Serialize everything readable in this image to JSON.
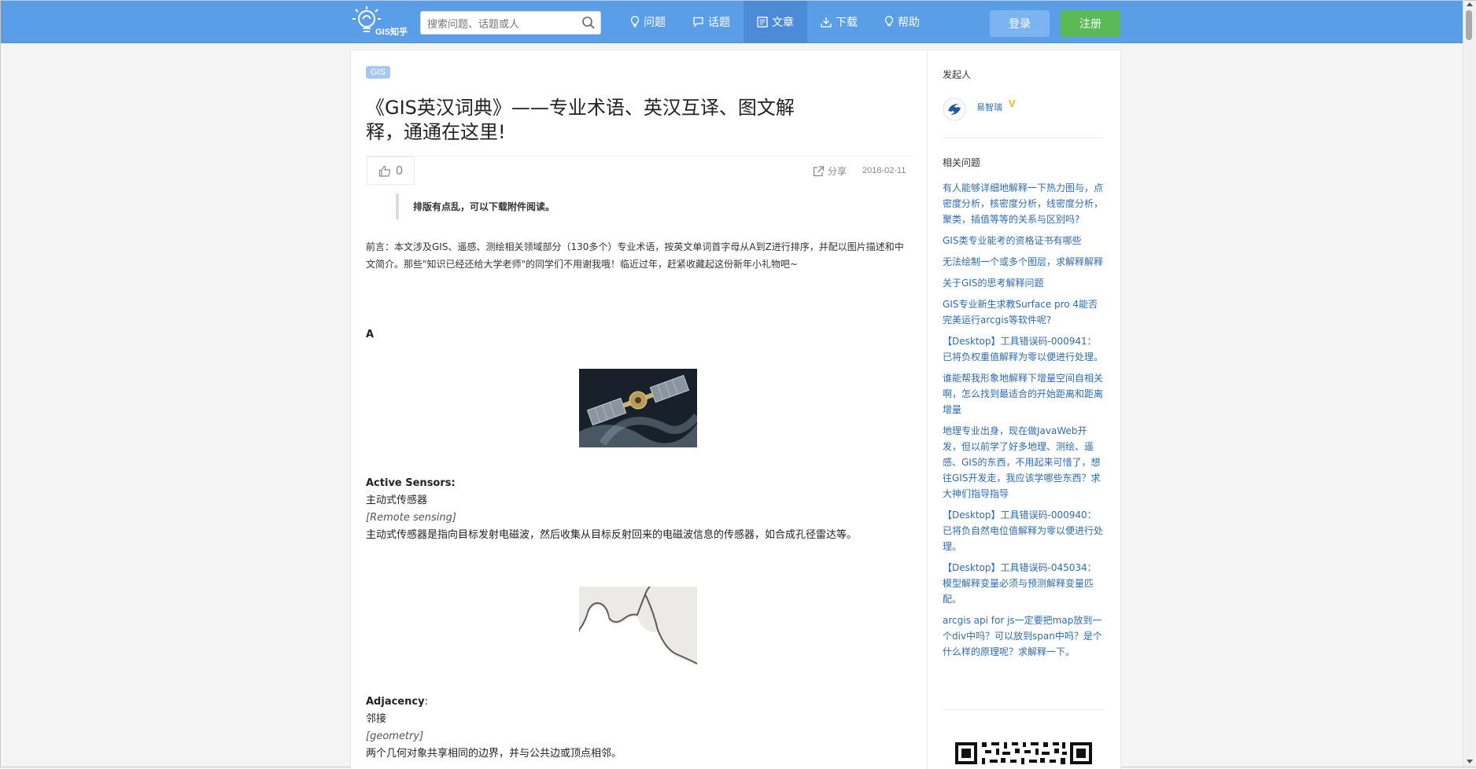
{
  "header": {
    "logo_text": "GIS知乎",
    "search_placeholder": "搜索问题、话题或人",
    "nav": [
      {
        "label": "问题",
        "icon": "bulb-icon"
      },
      {
        "label": "话题",
        "icon": "chat-icon"
      },
      {
        "label": "文章",
        "icon": "article-icon"
      },
      {
        "label": "下载",
        "icon": "download-icon"
      },
      {
        "label": "帮助",
        "icon": "help-bulb-icon"
      }
    ],
    "login": "登录",
    "register": "注册"
  },
  "article": {
    "tag": "GIS",
    "title_line1": "《GIS英汉词典》——专业术语、英汉互译、图文解",
    "title_line2": "释，通通在这里!",
    "likes": "0",
    "share": "分享",
    "date": "2018-02-11",
    "quote": "排版有点乱，可以下载附件阅读。",
    "intro": "前言：本文涉及GIS、遥感、测绘相关领域部分（130多个）专业术语，按英文单词首字母从A到Z进行排序，并配以图片描述和中文简介。那些\"知识已经还给大学老师\"的同学们不用谢我哦！临近过年，赶紧收藏起这份新年小礼物吧~",
    "section_letter": "A",
    "terms": [
      {
        "en": "Active Sensors:",
        "zh": "主动式传感器",
        "category": "[Remote sensing]",
        "desc": "主动式传感器是指向目标发射电磁波，然后收集从目标反射回来的电磁波信息的传感器，如合成孔径雷达等。"
      },
      {
        "en": "Adjacency",
        "en_suffix": ":",
        "zh": "邻接",
        "category": "[geometry]",
        "desc": "两个几何对象共享相同的边界，并与公共边或顶点相邻。"
      }
    ]
  },
  "sidebar": {
    "initiator_heading": "发起人",
    "author_name": "易智瑞",
    "verified_badge": "V",
    "related_heading": "相关问题",
    "questions": [
      "有人能够详细地解释一下热力图与，点密度分析，核密度分析，线密度分析，聚类，插值等等的关系与区别吗?",
      "GIS类专业能考的资格证书有哪些",
      "无法绘制一个或多个图层，求解释解释",
      "关于GIS的思考解释问题",
      "GIS专业新生求教Surface pro 4能否完美运行arcgis等软件呢?",
      "【Desktop】工具错误码-000941：已将负权重值解释为零以便进行处理。",
      "谁能帮我形象地解释下增量空间自相关啊，怎么找到最适合的开始距离和距离增量",
      "地理专业出身，现在做JavaWeb开发，但以前学了好多地理、测绘、遥感、GIS的东西，不用起来可惜了，想往GIS开发走，我应该学哪些东西？求大神们指导指导",
      "【Desktop】工具错误码-000940：已将负自然电位值解释为零以便进行处理。",
      "【Desktop】工具错误码-045034：模型解释变量必须与预测解释变量匹配。",
      "arcgis api for js一定要把map放到一个div中吗？可以放到span中吗？是个什么样的原理呢？求解释一下。"
    ]
  },
  "colors": {
    "topbar": "#5a9ee8",
    "nav_active": "#4b8bd8",
    "login_button": "#7cb4f2",
    "register_button": "#5cba56",
    "link": "#2a6cb7",
    "verified": "#f2b31c"
  }
}
